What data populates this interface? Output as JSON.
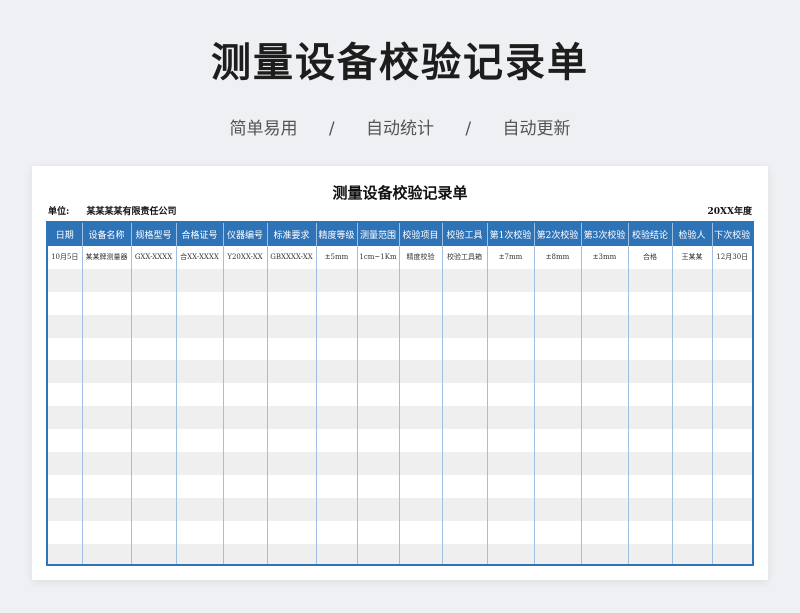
{
  "header": {
    "title": "测量设备校验记录单",
    "features": [
      "简单易用",
      "自动统计",
      "自动更新"
    ],
    "separator": "/"
  },
  "sheet": {
    "title": "测量设备校验记录单",
    "unit_label": "单位:",
    "unit_value": "某某某某有限责任公司",
    "year": "20XX年度"
  },
  "table": {
    "columns": [
      "日期",
      "设备名称",
      "规格型号",
      "合格证号",
      "仪器编号",
      "标准要求",
      "精度等级",
      "测量范围",
      "校验项目",
      "校验工具",
      "第1次校验",
      "第2次校验",
      "第3次校验",
      "校验结论",
      "检验人",
      "下次校验"
    ],
    "rows": [
      [
        "10月5日",
        "某某牌测量器",
        "GXX-XXXX",
        "合XX-XXXX",
        "Y20XX-XX",
        "GBXXXX-XX",
        "±5mm",
        "1cm~1Km",
        "精度校验",
        "校验工具箱",
        "±7mm",
        "±8mm",
        "±3mm",
        "合格",
        "王某某",
        "12月30日"
      ],
      [
        "",
        "",
        "",
        "",
        "",
        "",
        "",
        "",
        "",
        "",
        "",
        "",
        "",
        "",
        "",
        ""
      ],
      [
        "",
        "",
        "",
        "",
        "",
        "",
        "",
        "",
        "",
        "",
        "",
        "",
        "",
        "",
        "",
        ""
      ],
      [
        "",
        "",
        "",
        "",
        "",
        "",
        "",
        "",
        "",
        "",
        "",
        "",
        "",
        "",
        "",
        ""
      ],
      [
        "",
        "",
        "",
        "",
        "",
        "",
        "",
        "",
        "",
        "",
        "",
        "",
        "",
        "",
        "",
        ""
      ],
      [
        "",
        "",
        "",
        "",
        "",
        "",
        "",
        "",
        "",
        "",
        "",
        "",
        "",
        "",
        "",
        ""
      ],
      [
        "",
        "",
        "",
        "",
        "",
        "",
        "",
        "",
        "",
        "",
        "",
        "",
        "",
        "",
        "",
        ""
      ],
      [
        "",
        "",
        "",
        "",
        "",
        "",
        "",
        "",
        "",
        "",
        "",
        "",
        "",
        "",
        "",
        ""
      ],
      [
        "",
        "",
        "",
        "",
        "",
        "",
        "",
        "",
        "",
        "",
        "",
        "",
        "",
        "",
        "",
        ""
      ],
      [
        "",
        "",
        "",
        "",
        "",
        "",
        "",
        "",
        "",
        "",
        "",
        "",
        "",
        "",
        "",
        ""
      ],
      [
        "",
        "",
        "",
        "",
        "",
        "",
        "",
        "",
        "",
        "",
        "",
        "",
        "",
        "",
        "",
        ""
      ],
      [
        "",
        "",
        "",
        "",
        "",
        "",
        "",
        "",
        "",
        "",
        "",
        "",
        "",
        "",
        "",
        ""
      ],
      [
        "",
        "",
        "",
        "",
        "",
        "",
        "",
        "",
        "",
        "",
        "",
        "",
        "",
        "",
        "",
        ""
      ],
      [
        "",
        "",
        "",
        "",
        "",
        "",
        "",
        "",
        "",
        "",
        "",
        "",
        "",
        "",
        "",
        ""
      ]
    ]
  },
  "colors": {
    "header_blue": "#2f73b7",
    "stripe": "#efefef",
    "background": "#eef0f3"
  }
}
